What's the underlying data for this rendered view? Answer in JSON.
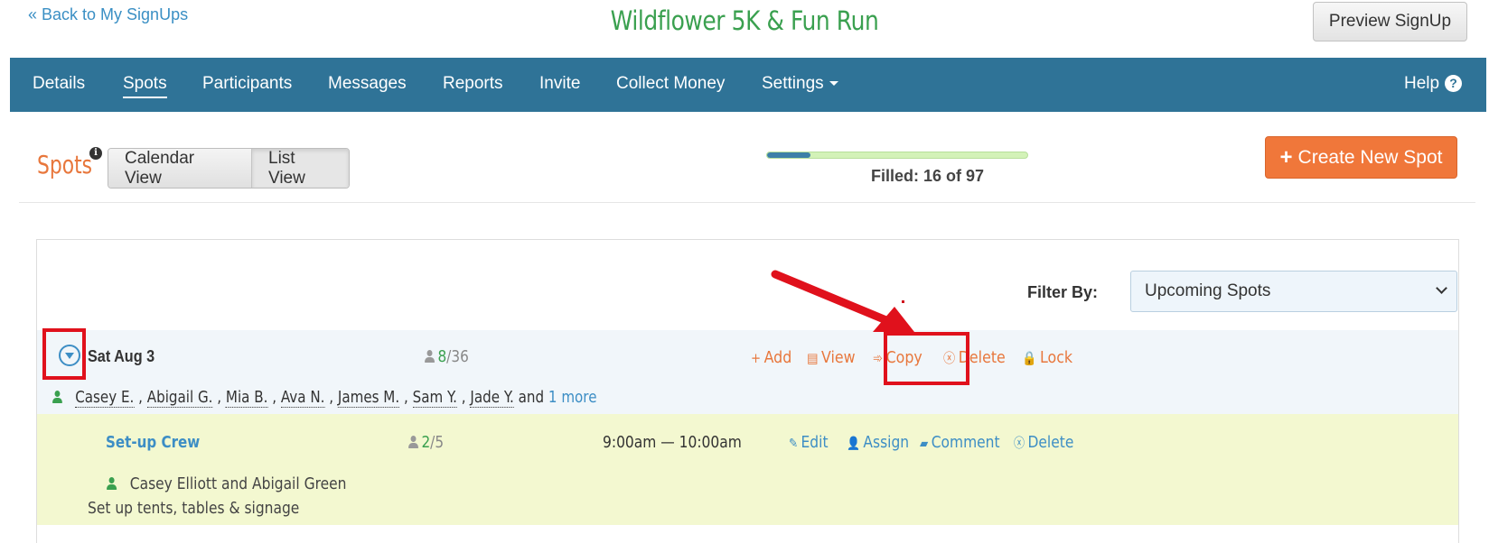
{
  "header": {
    "back_link": "« Back to My SignUps",
    "event_title": "Wildflower 5K & Fun Run",
    "preview_button": "Preview SignUp"
  },
  "nav": {
    "items": [
      {
        "label": "Details"
      },
      {
        "label": "Spots",
        "active": true
      },
      {
        "label": "Participants"
      },
      {
        "label": "Messages"
      },
      {
        "label": "Reports"
      },
      {
        "label": "Invite"
      },
      {
        "label": "Collect Money"
      },
      {
        "label": "Settings"
      }
    ],
    "help": "Help",
    "help_icon": "question-circle-icon",
    "settings_icon": "caret-down-icon"
  },
  "spots_bar": {
    "heading": "Spots",
    "info_icon": "info-circle-icon",
    "calendar_view": "Calendar View",
    "list_view": "List View",
    "selected_view": "List View",
    "progress_fraction": 0.165,
    "filled_text": "Filled: 16 of 97",
    "create_button": "Create New Spot",
    "create_icon": "plus-icon"
  },
  "filter": {
    "label": "Filter By:",
    "value": "Upcoming Spots",
    "icon": "chevron-down-icon"
  },
  "date_group": {
    "date": "Sat Aug 3",
    "expand_icon": "collapse-circle-icon",
    "count_filled": "8",
    "count_total": "/36",
    "actions": [
      {
        "icon": "plus-icon",
        "glyph": "+",
        "label": "Add"
      },
      {
        "icon": "document-icon",
        "glyph": "▤",
        "label": "View"
      },
      {
        "icon": "copy-arrows-icon",
        "glyph": "➾",
        "label": "Copy"
      },
      {
        "icon": "circle-x-icon",
        "glyph": "ⓧ",
        "label": "Delete"
      },
      {
        "icon": "lock-icon",
        "glyph": "🔒",
        "label": "Lock"
      }
    ],
    "participants": [
      "Casey E.",
      "Abigail G.",
      "Mia B.",
      "Ava N.",
      "James M.",
      "Sam Y.",
      "Jade Y."
    ],
    "and_text": "and",
    "more_link": "1 more"
  },
  "slot": {
    "name": "Set-up Crew",
    "count_filled": "2",
    "count_total": "/5",
    "time": "9:00am  —  10:00am",
    "actions": [
      {
        "icon": "pencil-icon",
        "glyph": "✎",
        "label": "Edit"
      },
      {
        "icon": "user-icon",
        "glyph": "👤",
        "label": "Assign"
      },
      {
        "icon": "comment-icon",
        "glyph": "▰",
        "label": "Comment"
      },
      {
        "icon": "circle-x-icon",
        "glyph": "ⓧ",
        "label": "Delete"
      }
    ],
    "people": "Casey Elliott and Abigail Green",
    "description": "Set up tents, tables & signage"
  },
  "colors": {
    "nav_bg": "#2f7397",
    "accent_orange": "#f0773a",
    "title_green": "#3aa04f",
    "link_blue": "#3d8ec5",
    "annotation_red": "#e0111c"
  }
}
